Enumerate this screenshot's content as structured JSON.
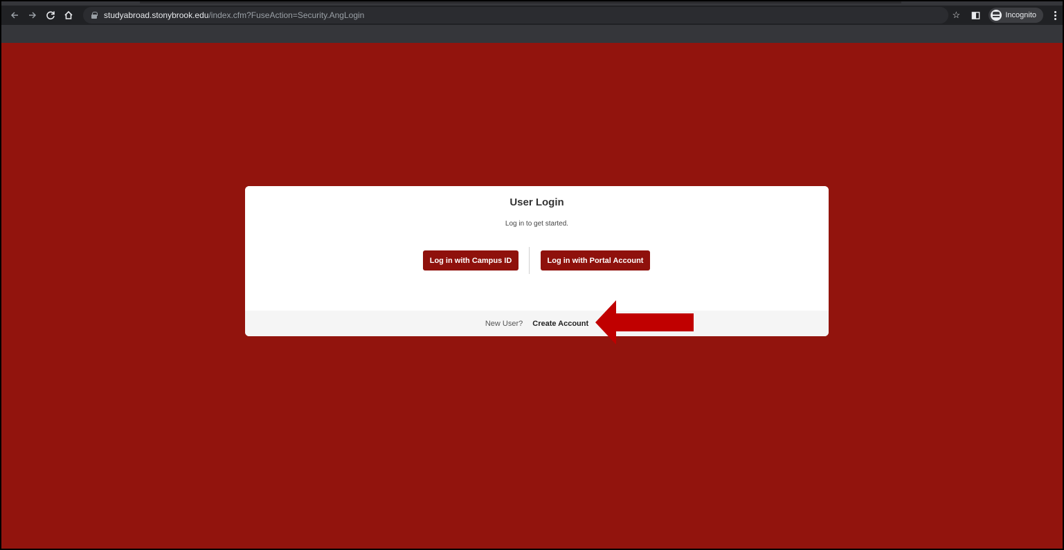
{
  "browser": {
    "url_host": "studyabroad.stonybrook.edu",
    "url_path": "/index.cfm?FuseAction=Security.AngLogin",
    "incognito_label": "Incognito",
    "icons": {
      "back": "arrow-left-icon",
      "forward": "arrow-right-icon",
      "reload": "reload-icon",
      "home": "home-icon",
      "lock": "lock-icon",
      "bookmark": "star-icon",
      "side_panel": "side-panel-icon",
      "incognito": "incognito-icon",
      "menu": "kebab-menu-icon"
    }
  },
  "login": {
    "title": "User Login",
    "subtitle": "Log in to get started.",
    "campus_button": "Log in with Campus ID",
    "portal_button": "Log in with Portal Account",
    "new_user_label": "New User?",
    "create_account_link": "Create Account"
  },
  "colors": {
    "page_background": "#92140d",
    "button_background": "#8f110c",
    "annotation_arrow": "#c00000"
  }
}
